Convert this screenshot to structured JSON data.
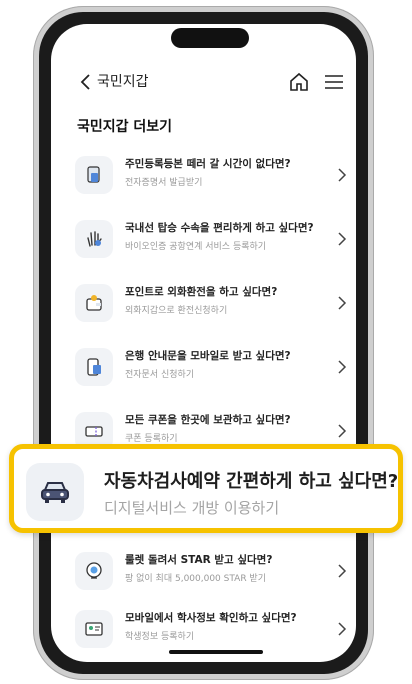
{
  "header": {
    "title": "국민지갑"
  },
  "section_title": "국민지갑 더보기",
  "items": [
    {
      "title": "주민등록등본 떼러 갈 시간이 없다면?",
      "subtitle": "전자증명서 발급받기",
      "icon": "document-icon"
    },
    {
      "title": "국내선 탑승 수속을 편리하게 하고 싶다면?",
      "subtitle": "바이오인증 공항연계 서비스 등록하기",
      "icon": "palm-scan-icon"
    },
    {
      "title": "포인트로 외화환전을 하고 싶다면?",
      "subtitle": "외화지갑으로 환전신청하기",
      "icon": "wallet-icon"
    },
    {
      "title": "은행 안내문을 모바일로 받고 싶다면?",
      "subtitle": "전자문서 신청하기",
      "icon": "mobile-document-icon"
    },
    {
      "title": "모든 쿠폰을 한곳에 보관하고 싶다면?",
      "subtitle": "쿠폰 등록하기",
      "icon": "coupon-icon"
    },
    {
      "title": "룰렛 돌려서 STAR 받고 싶다면?",
      "subtitle": "팡 없이 최대 5,000,000 STAR 받기",
      "icon": "roulette-icon"
    },
    {
      "title": "모바일에서 학사정보 확인하고 싶다면?",
      "subtitle": "학생정보 등록하기",
      "icon": "student-card-icon"
    }
  ],
  "callout": {
    "title": "자동차검사예약 간편하게 하고 싶다면?",
    "subtitle": "디지털서비스 개방 이용하기",
    "icon": "car-icon"
  }
}
